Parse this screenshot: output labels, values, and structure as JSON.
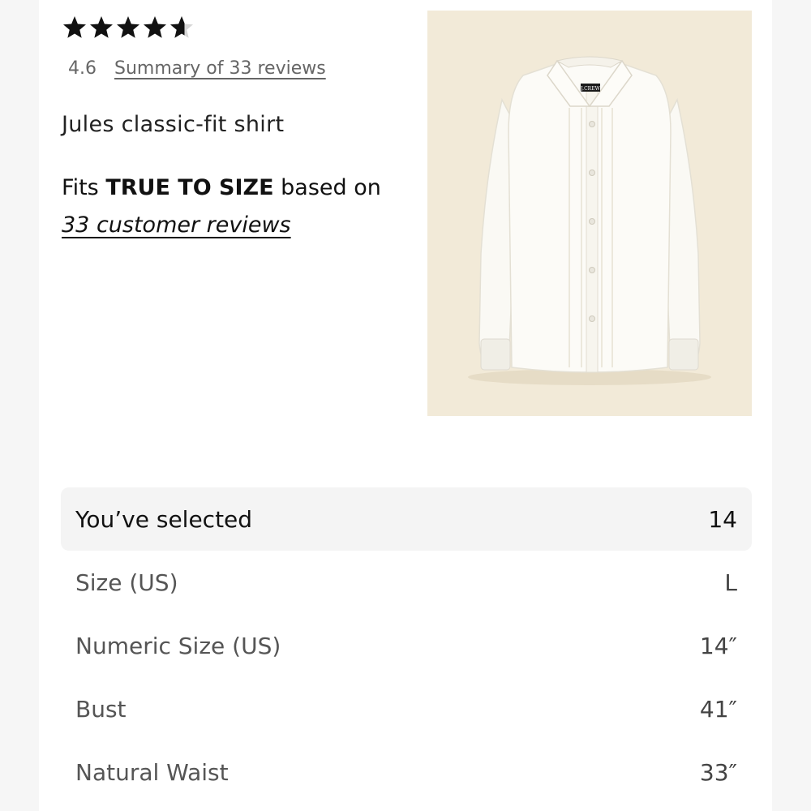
{
  "rating": {
    "stars_filled": 4.6,
    "score": "4.6",
    "summary_link": "Summary of 33 reviews"
  },
  "product": {
    "name": "Jules classic-fit shirt",
    "image_alt": "White classic-fit shirt with pin-tuck front",
    "brand_label": "J.CREW"
  },
  "fit": {
    "prefix": "Fits ",
    "emphasis": "TRUE TO SIZE",
    "suffix": " based on",
    "link": "33 customer reviews"
  },
  "size_table": {
    "rows": [
      {
        "label": "You’ve selected",
        "value": "14"
      },
      {
        "label": "Size (US)",
        "value": "L"
      },
      {
        "label": "Numeric Size (US)",
        "value": "14″"
      },
      {
        "label": "Bust",
        "value": "41″"
      },
      {
        "label": "Natural Waist",
        "value": "33″"
      }
    ]
  },
  "colors": {
    "star": "#111111",
    "image_background": "#f2ead8",
    "selected_row": "#f4f4f4"
  }
}
